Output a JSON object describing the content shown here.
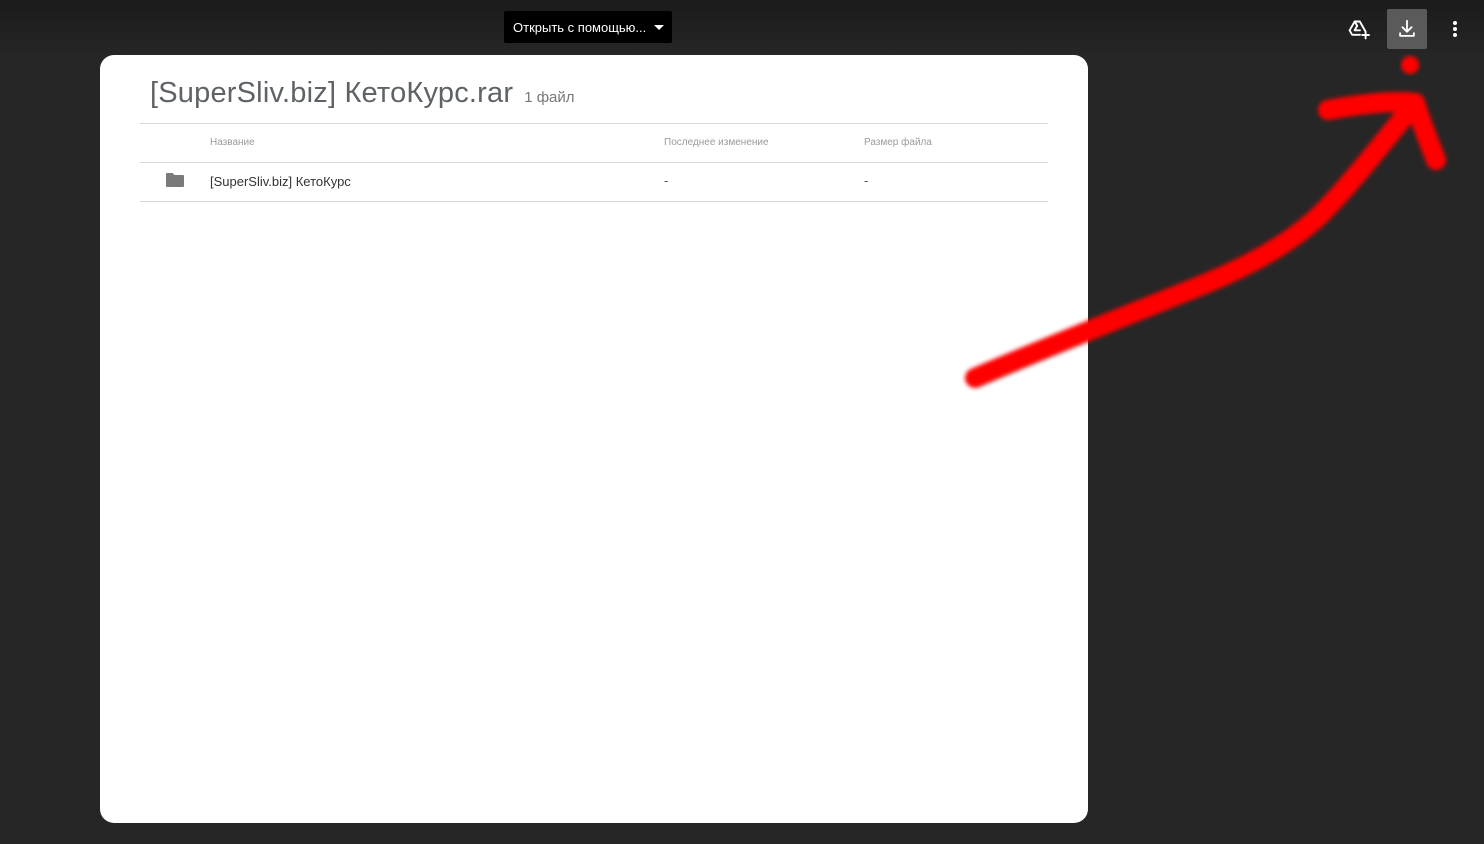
{
  "toolbar": {
    "open_with_label": "Открыть с помощью...",
    "icons": [
      "add-to-drive-icon",
      "download-icon",
      "more-vert-icon"
    ]
  },
  "archive": {
    "title": "[SuperSliv.biz] КетоКурс.rar",
    "file_count": "1 файл",
    "columns": {
      "name": "Название",
      "modified": "Последнее изменение",
      "size": "Размер файла"
    },
    "rows": [
      {
        "icon": "folder-icon",
        "name": "[SuperSliv.biz] КетоКурс",
        "modified": "-",
        "size": "-"
      }
    ]
  },
  "colors": {
    "background": "#262626",
    "card": "#ffffff",
    "annotation_stroke": "#ff0000",
    "button_active": "#5a5a5a"
  }
}
